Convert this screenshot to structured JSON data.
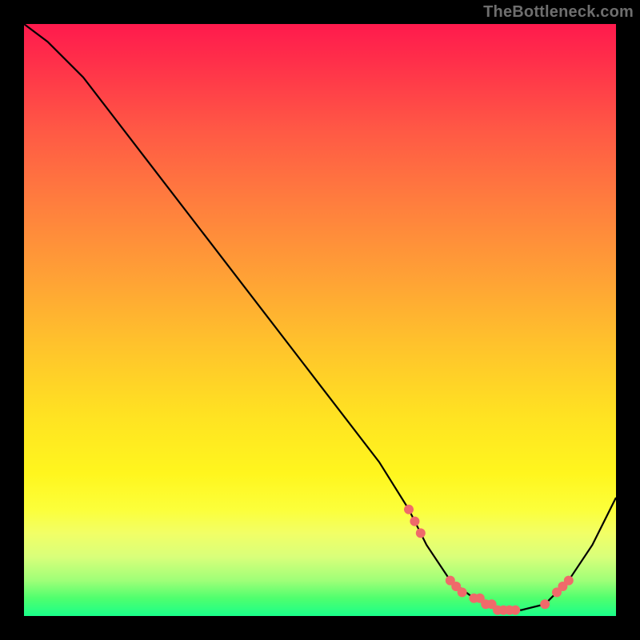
{
  "attribution": "TheBottleneck.com",
  "chart_data": {
    "type": "line",
    "title": "",
    "xlabel": "",
    "ylabel": "",
    "xlim": [
      0,
      100
    ],
    "ylim": [
      0,
      100
    ],
    "grid": false,
    "legend": false,
    "series": [
      {
        "name": "curve",
        "x": [
          0,
          4,
          10,
          20,
          30,
          40,
          50,
          60,
          65,
          68,
          72,
          76,
          80,
          84,
          88,
          92,
          96,
          100
        ],
        "y": [
          100,
          97,
          91,
          78,
          65,
          52,
          39,
          26,
          18,
          12,
          6,
          3,
          1,
          1,
          2,
          6,
          12,
          20
        ]
      }
    ],
    "markers": {
      "name": "highlight-points",
      "color": "#ef6a6a",
      "x": [
        65,
        66,
        67,
        72,
        73,
        74,
        76,
        77,
        78,
        79,
        80,
        81,
        82,
        83,
        88,
        90,
        91,
        92
      ],
      "y": [
        18,
        16,
        14,
        6,
        5,
        4,
        3,
        3,
        2,
        2,
        1,
        1,
        1,
        1,
        2,
        4,
        5,
        6
      ]
    },
    "background_gradient": {
      "stops": [
        {
          "pos": 0.0,
          "color": "#ff1a4d"
        },
        {
          "pos": 0.3,
          "color": "#ff7d3e"
        },
        {
          "pos": 0.66,
          "color": "#ffe222"
        },
        {
          "pos": 0.9,
          "color": "#d9ff7a"
        },
        {
          "pos": 1.0,
          "color": "#1aff8a"
        }
      ]
    }
  }
}
